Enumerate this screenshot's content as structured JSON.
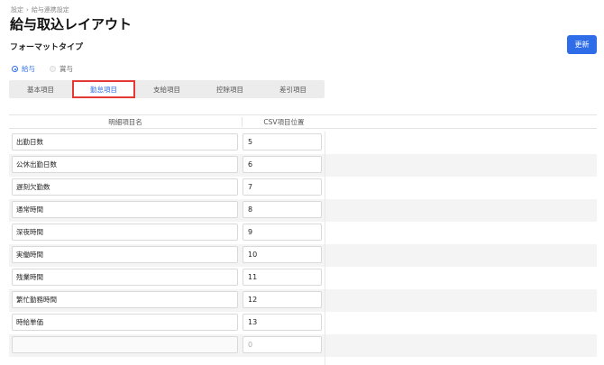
{
  "breadcrumb": [
    "設定",
    "給与連携設定"
  ],
  "page_title": "給与取込レイアウト",
  "section_title": "フォーマットタイプ",
  "update_button": "更新",
  "radio_options": [
    {
      "label": "給与",
      "selected": true
    },
    {
      "label": "賞与",
      "selected": false
    }
  ],
  "tabs": [
    {
      "label": "基本項目",
      "active": false
    },
    {
      "label": "勤怠項目",
      "active": true
    },
    {
      "label": "支給項目",
      "active": false
    },
    {
      "label": "控除項目",
      "active": false
    },
    {
      "label": "差引項目",
      "active": false
    }
  ],
  "table": {
    "headers": [
      "明細項目名",
      "CSV項目位置"
    ],
    "rows": [
      {
        "name": "出勤日数",
        "position": "5"
      },
      {
        "name": "公休出勤日数",
        "position": "6"
      },
      {
        "name": "遅刻欠勤数",
        "position": "7"
      },
      {
        "name": "通常時間",
        "position": "8"
      },
      {
        "name": "深夜時間",
        "position": "9"
      },
      {
        "name": "実働時間",
        "position": "10"
      },
      {
        "name": "残業時間",
        "position": "11"
      },
      {
        "name": "繁忙勤務時間",
        "position": "12"
      },
      {
        "name": "時給単価",
        "position": "13"
      },
      {
        "name": "",
        "position": "",
        "position_placeholder": "0"
      }
    ]
  },
  "colors": {
    "accent": "#2f6de8",
    "highlight_border": "#e53935"
  }
}
